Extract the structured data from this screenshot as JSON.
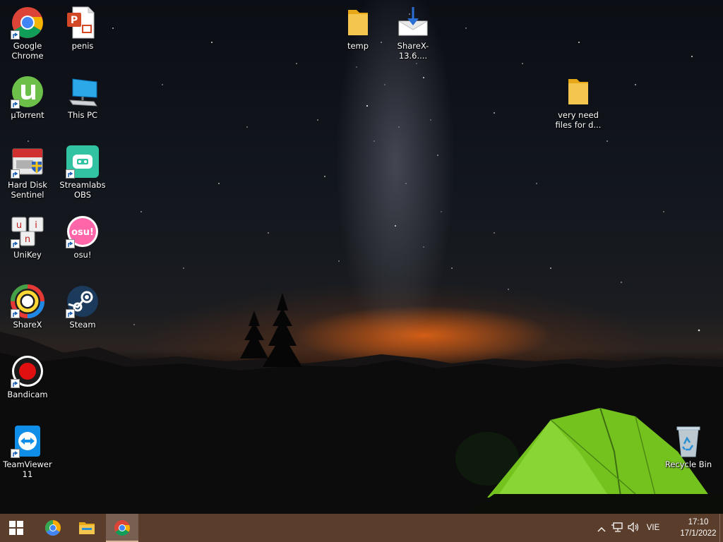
{
  "desktop": {
    "icons": [
      {
        "label": "Google Chrome",
        "icon": "chrome-icon"
      },
      {
        "label": "penis",
        "icon": "powerpoint-file-icon"
      },
      {
        "label": "µTorrent",
        "icon": "utorrent-icon"
      },
      {
        "label": "This PC",
        "icon": "this-pc-icon"
      },
      {
        "label": "Hard Disk Sentinel",
        "icon": "hard-disk-sentinel-icon"
      },
      {
        "label": "Streamlabs OBS",
        "icon": "streamlabs-obs-icon"
      },
      {
        "label": "UniKey",
        "icon": "unikey-icon"
      },
      {
        "label": "osu!",
        "icon": "osu-icon"
      },
      {
        "label": "ShareX",
        "icon": "sharex-icon"
      },
      {
        "label": "Steam",
        "icon": "steam-icon"
      },
      {
        "label": "Bandicam",
        "icon": "bandicam-icon"
      },
      {
        "label": "TeamViewer 11",
        "icon": "teamviewer-icon"
      },
      {
        "label": "temp",
        "icon": "folder-icon"
      },
      {
        "label": "ShareX-13.6....",
        "icon": "installer-icon"
      },
      {
        "label": "very need files for d...",
        "icon": "folder-icon"
      },
      {
        "label": "Recycle Bin",
        "icon": "recycle-bin-icon"
      }
    ]
  },
  "osu_text": "osu!",
  "unikey_letters": [
    "u",
    "i",
    "n"
  ],
  "taskbar": {
    "buttons": [
      {
        "name": "start-button",
        "icon": "windows-icon"
      },
      {
        "name": "chrome-canary-button",
        "icon": "chrome-canary-icon"
      },
      {
        "name": "file-explorer-button",
        "icon": "file-explorer-icon"
      },
      {
        "name": "chrome-button",
        "icon": "chrome-icon",
        "active": true
      }
    ],
    "tray": {
      "language": "VIE",
      "time": "17:10",
      "date": "17/1/2022"
    }
  },
  "colors": {
    "taskbar": "#5a3d2b",
    "tent": "#7ed321",
    "folder": "#f4c64e"
  }
}
